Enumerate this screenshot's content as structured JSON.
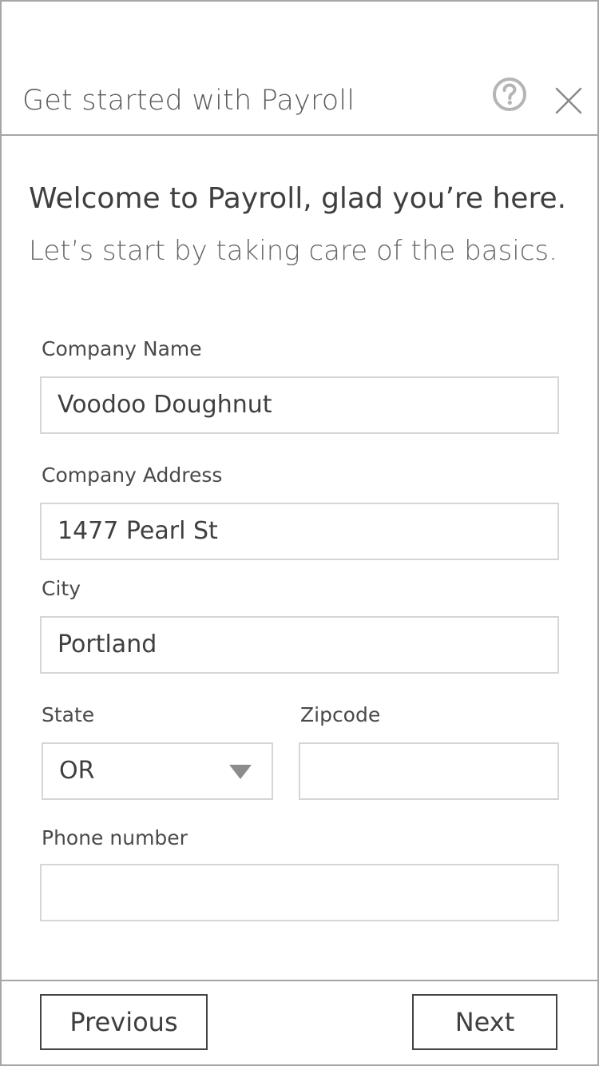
{
  "header": {
    "title": "Get started with Payroll",
    "help_icon": "question-circle-icon",
    "close_icon": "close-icon"
  },
  "intro": {
    "welcome": "Welcome to Payroll, glad you’re here.",
    "subtitle": "Let’s start by taking care of the basics."
  },
  "form": {
    "company_name": {
      "label": "Company Name",
      "value": "Voodoo Doughnut"
    },
    "company_address": {
      "label": "Company Address",
      "value": "1477 Pearl St"
    },
    "city": {
      "label": "City",
      "value": "Portland"
    },
    "state": {
      "label": "State",
      "value": "OR"
    },
    "zipcode": {
      "label": "Zipcode",
      "value": ""
    },
    "phone": {
      "label": "Phone number",
      "value": ""
    }
  },
  "footer": {
    "previous_label": "Previous",
    "next_label": "Next"
  },
  "colors": {
    "border": "#a6a6a6",
    "field_border": "#d6d6d6",
    "text": "#3f3f3f",
    "icon": "#b5b5b5"
  }
}
